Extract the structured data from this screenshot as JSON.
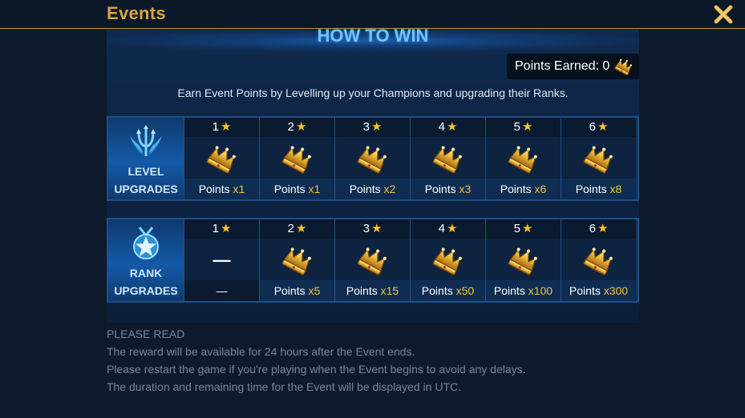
{
  "header": {
    "title": "Events",
    "close_icon": "close-x-icon",
    "accent": "#d9a441"
  },
  "banner": {
    "title": "HOW TO WIN"
  },
  "points_earned": {
    "label": "Points Earned: 0",
    "icon": "crown-icon"
  },
  "description": "Earn Event Points by Levelling up your Champions and upgrading their Ranks.",
  "level_table": {
    "label_line1": "LEVEL",
    "label_line2": "UPGRADES",
    "icon": "trident-emblem-icon",
    "columns": [
      {
        "star_count": "1",
        "points": "Points",
        "multiplier": "x1"
      },
      {
        "star_count": "2",
        "points": "Points",
        "multiplier": "x1"
      },
      {
        "star_count": "3",
        "points": "Points",
        "multiplier": "x2"
      },
      {
        "star_count": "4",
        "points": "Points",
        "multiplier": "x3"
      },
      {
        "star_count": "5",
        "points": "Points",
        "multiplier": "x6"
      },
      {
        "star_count": "6",
        "points": "Points",
        "multiplier": "x8"
      }
    ]
  },
  "rank_table": {
    "label_line1": "RANK",
    "label_line2": "UPGRADES",
    "icon": "star-medal-icon",
    "first_column": {
      "star_count": "1",
      "value": "—",
      "bottom": "—"
    },
    "columns": [
      {
        "star_count": "2",
        "points": "Points",
        "multiplier": "x5"
      },
      {
        "star_count": "3",
        "points": "Points",
        "multiplier": "x15"
      },
      {
        "star_count": "4",
        "points": "Points",
        "multiplier": "x50"
      },
      {
        "star_count": "5",
        "points": "Points",
        "multiplier": "x100"
      },
      {
        "star_count": "6",
        "points": "Points",
        "multiplier": "x300"
      }
    ]
  },
  "please_read": {
    "heading": "PLEASE READ",
    "lines": [
      "The reward will be available for 24 hours after the Event ends.",
      "Please restart the game if you're playing when the Event begins to avoid any delays.",
      "The duration and remaining time for the Event will be displayed in UTC."
    ]
  }
}
